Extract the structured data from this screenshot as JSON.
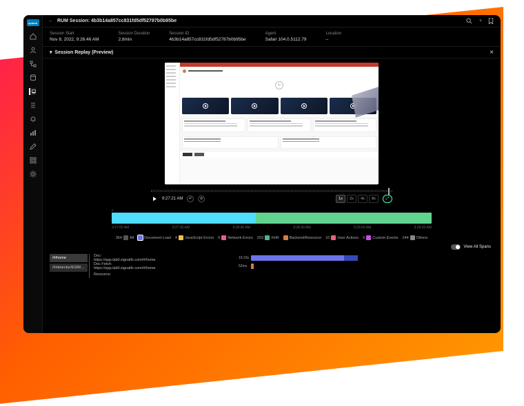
{
  "brand": "splunk",
  "back_icon": "←",
  "page_title": "RUM Session: 4b3b14a857cc831fd5df52787b0b95be",
  "topbar_icons": [
    "search",
    "plus",
    "bookmark"
  ],
  "meta": {
    "start_label": "Session Start",
    "start_value": "Nov 8, 2022, 9:26:46 AM",
    "duration_label": "Session Duration",
    "duration_value": "2.8min",
    "id_label": "Session ID",
    "id_value": "4b3b14a857cc831fd5df52787b0b95be",
    "agent_label": "Agent",
    "agent_value": "Safari 104.0.5112.79",
    "location_label": "Location",
    "location_value": "–"
  },
  "section_title": "Session Replay (Preview)",
  "player": {
    "current_time": "9:27:21 AM",
    "speeds": [
      "1x",
      "2x",
      "4x",
      "8x"
    ],
    "selected_speed": "1x"
  },
  "timeline_ticks": [
    "9:27:00 AM",
    "9:27:30 AM",
    "9:28:00 AM",
    "9:28:30 AM",
    "9:29:00 AM",
    "9:29:30 AM"
  ],
  "legend": [
    {
      "count": "364",
      "label": "All",
      "color": "#555"
    },
    {
      "count": "",
      "label": "Document Load",
      "color": "#6b74ea",
      "sel": true
    },
    {
      "count": "4",
      "label": "JavaScript Errors",
      "color": "#f5c04b"
    },
    {
      "count": "0",
      "label": "Network Errors",
      "color": "#e85f8a"
    },
    {
      "count": "253",
      "label": "XHR",
      "color": "#4fb38d"
    },
    {
      "count": "",
      "label": "Backend/Resource",
      "color": "#d87c3f"
    },
    {
      "count": "10",
      "label": "User Actions",
      "color": "#ea5f7a"
    },
    {
      "count": "6",
      "label": "Custom Events",
      "color": "#c94fe0"
    },
    {
      "count": "244",
      "label": "Others",
      "color": "#888"
    }
  ],
  "view_all_label": "View All Spans",
  "span_tabs": [
    "/#/home",
    "/#/detector/ESlW…"
  ],
  "span_rows": [
    {
      "name": "Doc:",
      "url": "https://app.lab0.signalfx.com/#/home",
      "dur": "19.23s"
    },
    {
      "name": "Doc Fetch:",
      "url": "https://app.lab0.signalfx.com/#/home",
      "dur": "52ms"
    },
    {
      "name": "Resource:",
      "url": "",
      "dur": ""
    }
  ]
}
